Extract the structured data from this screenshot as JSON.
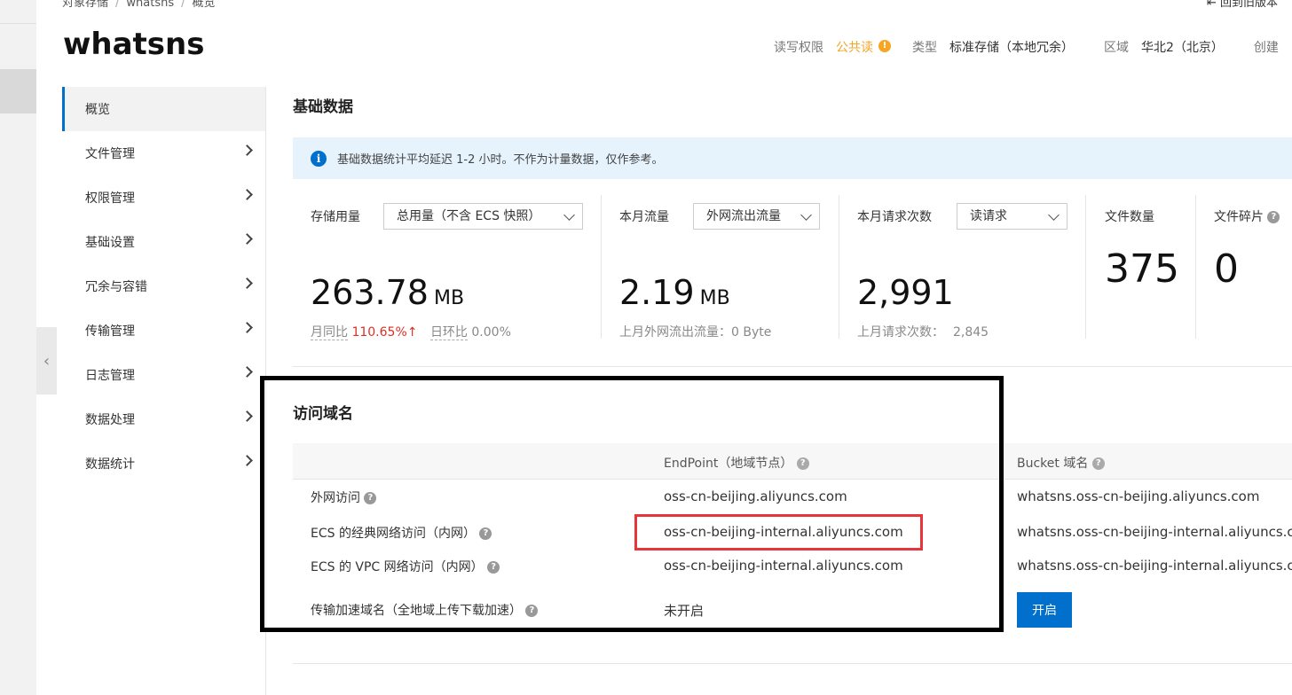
{
  "breadcrumb": [
    "对象存储",
    "whatsns",
    "概览"
  ],
  "back_link": "回到旧版本",
  "bucket": {
    "name": "whatsns",
    "meta": {
      "perm_label": "读写权限",
      "perm_value": "公共读",
      "type_label": "类型",
      "type_value": "标准存储（本地冗余）",
      "region_label": "区域",
      "region_value": "华北2（北京）",
      "created_label": "创建"
    }
  },
  "nav": {
    "items": [
      {
        "label": "概览"
      },
      {
        "label": "文件管理"
      },
      {
        "label": "权限管理"
      },
      {
        "label": "基础设置"
      },
      {
        "label": "冗余与容错"
      },
      {
        "label": "传输管理"
      },
      {
        "label": "日志管理"
      },
      {
        "label": "数据处理"
      },
      {
        "label": "数据统计"
      }
    ]
  },
  "basic": {
    "title": "基础数据",
    "notice": "基础数据统计平均延迟 1-2 小时。不作为计量数据，仅作参考。",
    "storage": {
      "label": "存储用量",
      "select": "总用量（不含 ECS 快照）",
      "value": "263.78",
      "unit": "MB",
      "yoy_label": "月同比",
      "yoy_value": "110.65%",
      "dod_label": "日环比",
      "dod_value": "0.00%"
    },
    "traffic": {
      "label": "本月流量",
      "select": "外网流出流量",
      "value": "2.19",
      "unit": "MB",
      "sub": "上月外网流出流量：0 Byte"
    },
    "requests": {
      "label": "本月请求次数",
      "select": "读请求",
      "value": "2,991",
      "sub_label": "上月请求次数：",
      "sub_value": "2,845"
    },
    "files": {
      "label": "文件数量",
      "value": "375"
    },
    "fragments": {
      "label": "文件碎片",
      "value": "0"
    }
  },
  "domains": {
    "title": "访问域名",
    "col_endpoint": "EndPoint（地域节点）",
    "col_bucket": "Bucket 域名",
    "rows": [
      {
        "name": "外网访问",
        "endpoint": "oss-cn-beijing.aliyuncs.com",
        "bucket": "whatsns.oss-cn-beijing.aliyuncs.com"
      },
      {
        "name": "ECS 的经典网络访问（内网）",
        "endpoint": "oss-cn-beijing-internal.aliyuncs.com",
        "bucket": "whatsns.oss-cn-beijing-internal.aliyuncs.com"
      },
      {
        "name": "ECS 的 VPC 网络访问（内网）",
        "endpoint": "oss-cn-beijing-internal.aliyuncs.com",
        "bucket": "whatsns.oss-cn-beijing-internal.aliyuncs.com"
      },
      {
        "name": "传输加速域名（全地域上传下载加速）",
        "endpoint": "未开启",
        "button": "开启"
      }
    ]
  },
  "colors": {
    "accent": "#0070cc",
    "warning": "#f5a623",
    "up": "#d93026",
    "highlight_box": "#e8343b"
  }
}
